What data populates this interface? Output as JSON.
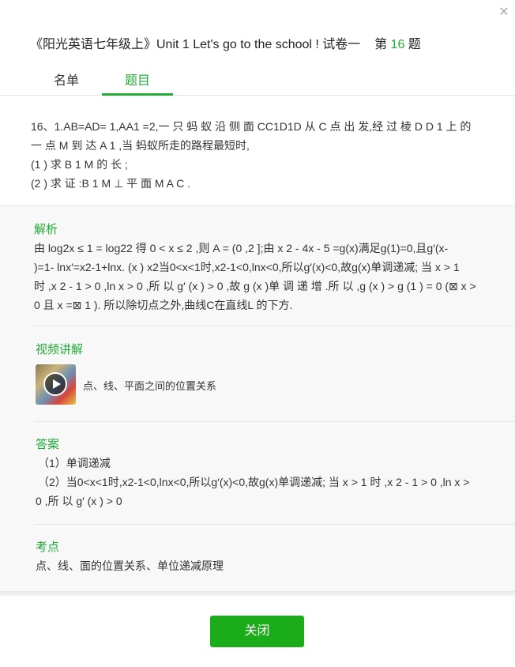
{
  "dialog": {
    "title_prefix": "《阳光英语七年级上》Unit 1 Let's go to the school ! 试卷一",
    "title_q_pre": "第",
    "title_q_num": "16",
    "title_q_post": "题"
  },
  "tabs": [
    {
      "label": "名单"
    },
    {
      "label": "题目"
    }
  ],
  "active_tab": "题目",
  "question": {
    "lines": [
      "16、1.AB=AD= 1,AA1 =2,一 只 蚂 蚁 沿 侧 面 CC1D1D 从 C 点 出 发,经 过 棱 D D 1 上 的",
      "一 点 M 到 达 A 1 ,当 蚂蚁所走的路程最短时,",
      "(1 ) 求 B 1 M 的 长 ;",
      "(2 ) 求 证 :B 1 M ⊥ 平 面 M A C ."
    ]
  },
  "analysis": {
    "heading": "解析",
    "lines": [
      "由 log2x ≤ 1 = log22 得 0 < x ≤ 2 ,则 A = (0 ,2 ];由 x 2 - 4x - 5 =g(x)满足g(1)=0,且g′(x-",
      ")=1- lnx′=x2-1+lnx. (x ) x2当0<x<1时,x2-1<0,lnx<0,所以g′(x)<0,故g(x)单调递减; 当 x > 1",
      "时 ,x 2 - 1 > 0 ,ln x > 0 ,所 以 g′ (x ) > 0 ,故 g (x )单 调 递 增 .所 以 ,g (x ) > g (1 ) = 0 (⊠ x >",
      "0 且 x =⊠ 1 ). 所以除切点之外,曲线C在直线L 的下方."
    ]
  },
  "video": {
    "heading": "视频讲解",
    "item_label": "点、线、平面之间的位置关系"
  },
  "answer": {
    "heading": "答案",
    "lines": [
      "（1）单调递减",
      "（2）当0<x<1时,x2-1<0,lnx<0,所以g′(x)<0,故g(x)单调递减; 当 x > 1 时 ,x 2 - 1 > 0 ,ln x >",
      "0 ,所 以 g′ (x ) > 0"
    ]
  },
  "knowledge_point": {
    "heading": "考点",
    "text": "点、线、面的位置关系、单位递减原理"
  },
  "footer": {
    "close_label": "关闭"
  },
  "colors": {
    "accent": "#22ac38",
    "button": "#1aad19",
    "section_bg": "#f8f8f8"
  },
  "icons": {
    "close": "close-icon",
    "play": "play-icon"
  }
}
